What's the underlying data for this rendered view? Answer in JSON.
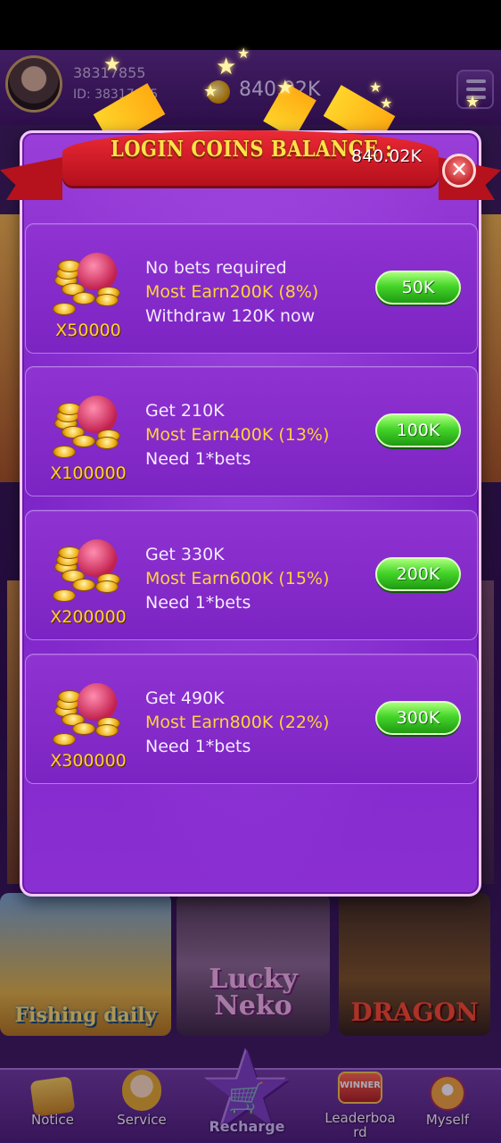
{
  "header": {
    "user_id": "38317855",
    "user_id_line": "ID: 38317855",
    "balance": "840.02K"
  },
  "games": [
    {
      "label": "Fishing daily"
    },
    {
      "label": "Lucky Neko"
    },
    {
      "label": "DRAGON"
    }
  ],
  "bottom_nav": {
    "items": [
      {
        "label": "Notice"
      },
      {
        "label": "Service"
      },
      {
        "label": "Recharge"
      },
      {
        "label": "Leaderboa rd"
      },
      {
        "label": "Myself"
      }
    ],
    "leaderboard_badge": "WINNER"
  },
  "modal": {
    "title": "LOGIN COINS BALANCE :",
    "balance": "840.02K",
    "close_label": "✕",
    "cards": [
      {
        "multiplier": "X50000",
        "line1": "No bets required",
        "line2": "Most Earn200K (8%)",
        "line3": "Withdraw 120K now",
        "button": "50K"
      },
      {
        "multiplier": "X100000",
        "line1": "Get 210K",
        "line2": "Most Earn400K (13%)",
        "line3": "Need 1*bets",
        "button": "100K"
      },
      {
        "multiplier": "X200000",
        "line1": "Get 330K",
        "line2": "Most Earn600K (15%)",
        "line3": "Need 1*bets",
        "button": "200K"
      },
      {
        "multiplier": "X300000",
        "line1": "Get 490K",
        "line2": "Most Earn800K (22%)",
        "line3": "Need 1*bets",
        "button": "300K"
      }
    ]
  },
  "colors": {
    "modal_purple": "#8a2fd2",
    "banner_red": "#d81d2a",
    "highlight_gold": "#ffd23a",
    "button_green": "#45d52a"
  }
}
